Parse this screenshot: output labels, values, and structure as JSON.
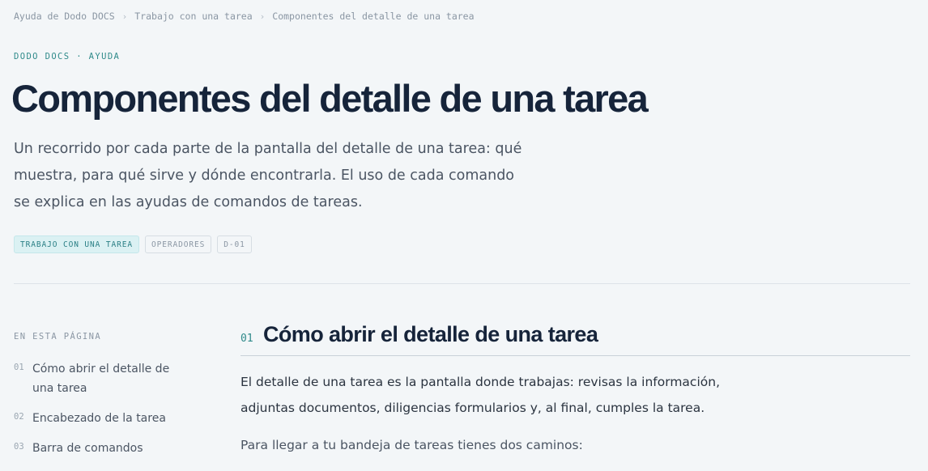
{
  "breadcrumb": {
    "items": [
      "Ayuda de Dodo DOCS",
      "Trabajo con una tarea"
    ],
    "current": "Componentes del detalle de una tarea",
    "separator": "›"
  },
  "eyebrow": "DODO DOCS · AYUDA",
  "page": {
    "title": "Componentes del detalle de una tarea",
    "lead": "Un recorrido por cada parte de la pantalla del detalle de una tarea: qué muestra, para qué sirve y dónde encontrarla. El uso de cada comando se explica en las ayudas de comandos de tareas."
  },
  "tags": [
    "TRABAJO CON UNA TAREA",
    "OPERADORES",
    "D-01"
  ],
  "toc": {
    "heading": "EN ESTA PÁGINA",
    "items": [
      {
        "num": "01",
        "label": "Cómo abrir el detalle de una tarea"
      },
      {
        "num": "02",
        "label": "Encabezado de la tarea"
      },
      {
        "num": "03",
        "label": "Barra de comandos"
      }
    ]
  },
  "section": {
    "num": "01",
    "title": "Cómo abrir el detalle de una tarea",
    "paragraphs": [
      "El detalle de una tarea es la pantalla donde trabajas: revisas la información, adjuntas documentos, diligencias formularios y, al final, cumples la tarea.",
      "Para llegar a tu bandeja de tareas tienes dos caminos:"
    ]
  },
  "colors": {
    "accent": "#2f8a8a",
    "title": "#16243a",
    "background": "#f3f6f8",
    "tag_primary_bg": "#dbf1f3"
  }
}
